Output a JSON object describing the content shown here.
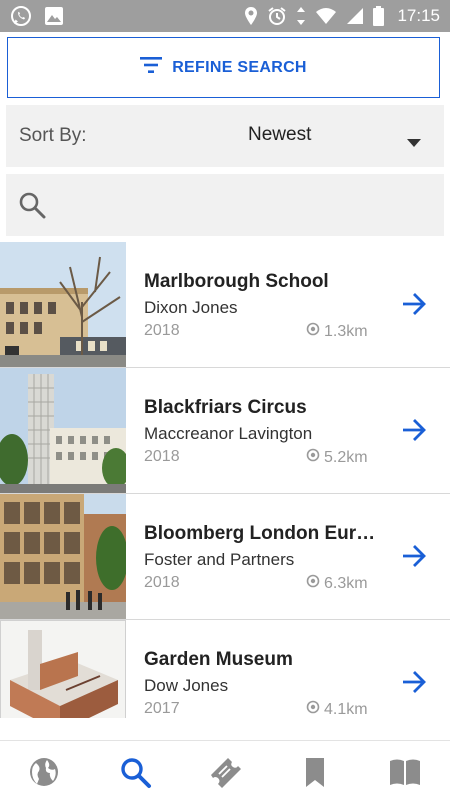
{
  "status_bar": {
    "time": "17:15",
    "left_icons": [
      "whatsapp-icon",
      "image-icon"
    ],
    "right_icons": [
      "location-icon",
      "alarm-icon",
      "data-arrows-icon",
      "wifi-icon",
      "signal-icon",
      "battery-icon"
    ]
  },
  "refine": {
    "label": "REFINE SEARCH",
    "icon": "filter-icon"
  },
  "sort": {
    "label": "Sort By:",
    "value": "Newest"
  },
  "search": {
    "placeholder": "",
    "value": ""
  },
  "results": [
    {
      "title": "Marlborough School",
      "architect": "Dixon Jones",
      "year": "2018",
      "distance": "1.3km"
    },
    {
      "title": "Blackfriars Circus",
      "architect": "Maccreanor Lavington",
      "year": "2018",
      "distance": "5.2km"
    },
    {
      "title": "Bloomberg London Euro…",
      "architect": "Foster and Partners",
      "year": "2018",
      "distance": "6.3km"
    },
    {
      "title": "Garden Museum",
      "architect": "Dow Jones",
      "year": "2017",
      "distance": "4.1km"
    }
  ],
  "colors": {
    "accent": "#1a5fd6",
    "status_bar": "#9e9e9e",
    "nav_inactive": "#8c8c8c"
  },
  "bottom_nav": {
    "items": [
      "globe-icon",
      "search-icon",
      "ticket-icon",
      "bookmark-icon",
      "book-icon"
    ],
    "active": "search-icon"
  }
}
